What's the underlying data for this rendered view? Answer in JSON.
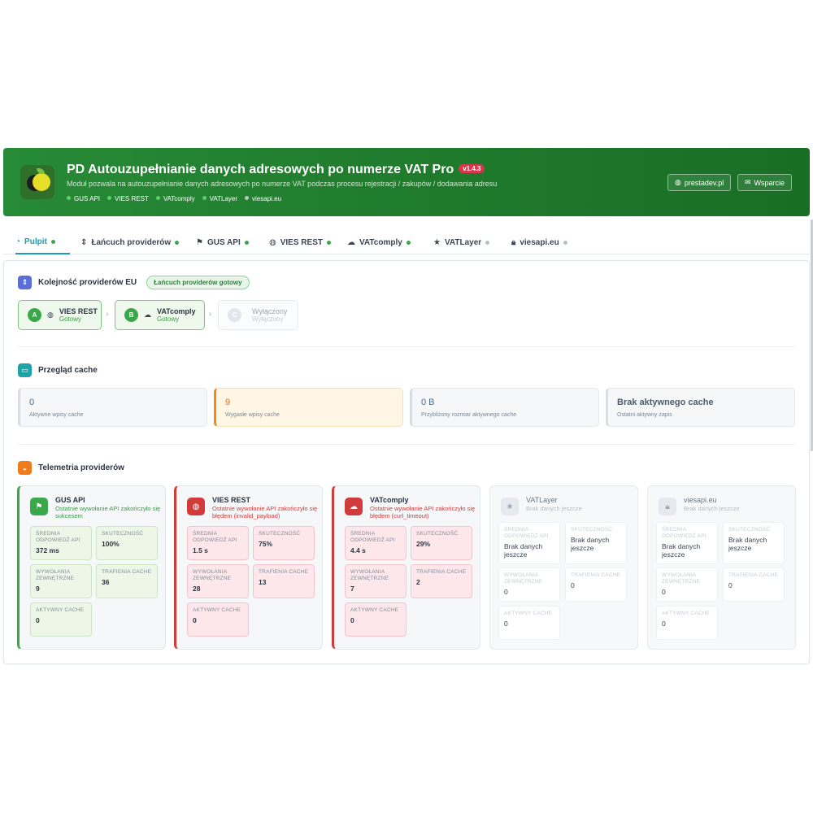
{
  "header": {
    "title": "PD Autouzupełnianie danych adresowych po numerze VAT Pro",
    "version": "v1.4.3",
    "description": "Moduł pozwala na autouzupełnianie danych adresowych po numerze VAT podczas procesu rejestracji / zakupów / dodawania adresu",
    "providers": [
      {
        "name": "GUS API",
        "active": true
      },
      {
        "name": "VIES REST",
        "active": true
      },
      {
        "name": "VATcomply",
        "active": true
      },
      {
        "name": "VATLayer",
        "active": true
      },
      {
        "name": "viesapi.eu",
        "active": true
      }
    ],
    "links": [
      {
        "label": "prestadev.pl",
        "icon": "globe-icon"
      },
      {
        "label": "Wsparcie",
        "icon": "envelope-icon"
      }
    ]
  },
  "tabs": [
    {
      "label": "Pulpit",
      "icon": "dashboard-icon",
      "status": "green",
      "active": true
    },
    {
      "label": "Łańcuch providerów",
      "icon": "sort-icon",
      "status": "green"
    },
    {
      "label": "GUS API",
      "icon": "flag-icon",
      "status": "green"
    },
    {
      "label": "VIES REST",
      "icon": "globe-icon",
      "status": "green"
    },
    {
      "label": "VATcomply",
      "icon": "cloud-icon",
      "status": "green"
    },
    {
      "label": "VATLayer",
      "icon": "star-icon",
      "status": "gray"
    },
    {
      "label": "viesapi.eu",
      "icon": "lock-icon",
      "status": "gray"
    }
  ],
  "chain": {
    "title": "Kolejność providerów EU",
    "badge": "Łańcuch providerów gotowy",
    "items": [
      {
        "letter": "A",
        "name": "VIES REST",
        "status": "Gotowy",
        "icon": "globe-icon"
      },
      {
        "letter": "B",
        "name": "VATcomply",
        "status": "Gotowy",
        "icon": "cloud-icon"
      },
      {
        "letter": "C",
        "name": "Wyłączony",
        "status": "Wyłączony"
      }
    ]
  },
  "cache": {
    "title": "Przegląd cache",
    "cards": [
      {
        "value": "0",
        "label": "Aktywne wpisy cache"
      },
      {
        "value": "9",
        "label": "Wygasłe wpisy cache"
      },
      {
        "value": "0 B",
        "label": "Przybliżony rozmiar aktywnego cache"
      },
      {
        "value": "Brak aktywnego cache",
        "label": "Ostatni aktywny zapis"
      }
    ]
  },
  "telemetry": {
    "title": "Telemetria providerów",
    "providers": [
      {
        "name": "GUS API",
        "icon": "flag-icon",
        "state": "ok",
        "message": "Ostatnie wywołanie API zakończyło się sukcesem",
        "metrics": {
          "avg_label": "Średnia odpowiedź API",
          "avg": "372 ms",
          "success_label": "Skuteczność",
          "success": "100%",
          "calls_label": "Wywołania zewnętrzne",
          "calls": "9",
          "hits_label": "Trafienia cache",
          "hits": "36",
          "active_label": "Aktywny cache",
          "active": "0"
        }
      },
      {
        "name": "VIES REST",
        "icon": "globe-icon",
        "state": "err",
        "message": "Ostatnie wywołanie API zakończyło się błędem (invalid_payload)",
        "metrics": {
          "avg_label": "Średnia odpowiedź API",
          "avg": "1.5 s",
          "success_label": "Skuteczność",
          "success": "75%",
          "calls_label": "Wywołania zewnętrzne",
          "calls": "28",
          "hits_label": "Trafienia cache",
          "hits": "13",
          "active_label": "Aktywny cache",
          "active": "0"
        }
      },
      {
        "name": "VATcomply",
        "icon": "cloud-icon",
        "state": "err",
        "message": "Ostatnie wywołanie API zakończyło się błędem (curl_timeout)",
        "metrics": {
          "avg_label": "Średnia odpowiedź API",
          "avg": "4.4 s",
          "success_label": "Skuteczność",
          "success": "29%",
          "calls_label": "Wywołania zewnętrzne",
          "calls": "7",
          "hits_label": "Trafienia cache",
          "hits": "2",
          "active_label": "Aktywny cache",
          "active": "0"
        }
      },
      {
        "name": "VATLayer",
        "icon": "star-icon",
        "state": "dis",
        "message": "Brak danych jeszcze",
        "metrics": {
          "avg_label": "Średnia odpowiedź API",
          "avg": "Brak danych jeszcze",
          "success_label": "Skuteczność",
          "success": "Brak danych jeszcze",
          "calls_label": "Wywołania zewnętrzne",
          "calls": "0",
          "hits_label": "Trafienia cache",
          "hits": "0",
          "active_label": "Aktywny cache",
          "active": "0"
        }
      },
      {
        "name": "viesapi.eu",
        "icon": "lock-icon",
        "state": "dis",
        "message": "Brak danych jeszcze",
        "metrics": {
          "avg_label": "Średnia odpowiedź API",
          "avg": "Brak danych jeszcze",
          "success_label": "Skuteczność",
          "success": "Brak danych jeszcze",
          "calls_label": "Wywołania zewnętrzne",
          "calls": "0",
          "hits_label": "Trafienia cache",
          "hits": "0",
          "active_label": "Aktywny cache",
          "active": "0"
        }
      }
    ]
  },
  "colors": {
    "header_green": "#1f7a2c",
    "tab_active": "#1c9bb8",
    "success": "#3aa84a",
    "error": "#d23b3b",
    "warning": "#f08a1a",
    "chain_icon": "#5b6dd6",
    "cache_icon": "#1fa3a8",
    "telemetry_icon": "#f07b1a"
  }
}
